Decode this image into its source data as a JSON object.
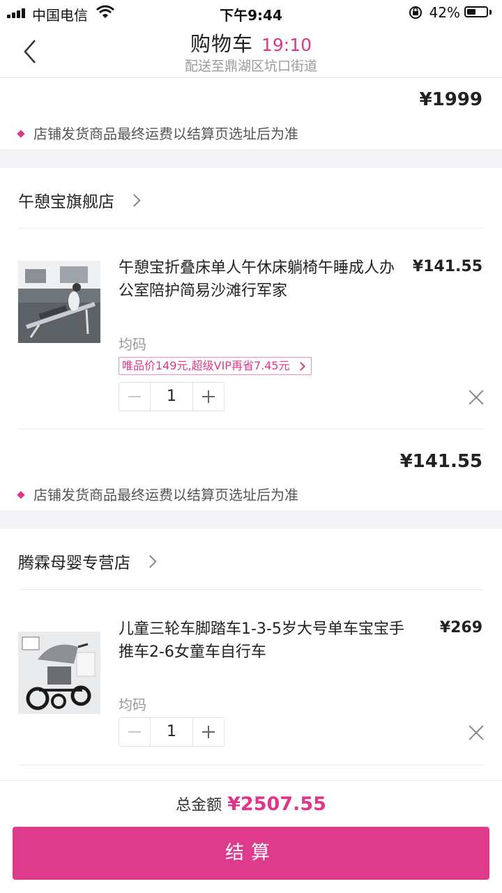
{
  "status_bar": {
    "carrier": "中国电信",
    "time": "下午9:44",
    "battery": "42%"
  },
  "nav": {
    "title": "购物车",
    "countdown": "19:10",
    "subtitle": "配送至鼎湖区坑口街道"
  },
  "top_section": {
    "subtotal": "¥1999",
    "shipping_note": "店铺发货商品最终运费以结算页选址后为准"
  },
  "stores": [
    {
      "name": "午憩宝旗舰店",
      "item": {
        "title": "午憩宝折叠床单人午休床躺椅午睡成人办公室陪护简易沙滩行军家",
        "price": "¥141.55",
        "spec": "均码",
        "vip_tag": "唯品价149元,超级VIP再省7.45元",
        "quantity": "1"
      },
      "subtotal": "¥141.55",
      "shipping_note": "店铺发货商品最终运费以结算页选址后为准"
    },
    {
      "name": "腾霖母婴专营店",
      "item": {
        "title": "儿童三轮车脚踏车1-3-5岁大号单车宝宝手推车2-6女童车自行车",
        "price": "¥269",
        "spec": "均码",
        "quantity": "1"
      }
    }
  ],
  "footer": {
    "total_label": "总金额",
    "total_amount": "¥2507.55",
    "checkout_label": "结算"
  },
  "colors": {
    "accent": "#e0368a",
    "checkout_bg": "#df3b8c"
  }
}
